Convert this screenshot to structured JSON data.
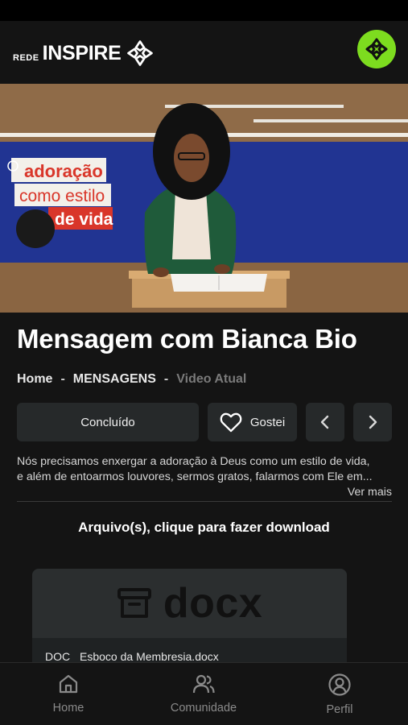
{
  "header": {
    "logo_prefix": "REDE",
    "logo_name": "INSPIRE",
    "logo_icon": "inspire-cross-logo",
    "avatar_icon": "inspire-cross-logo",
    "avatar_color": "#7ddc1f"
  },
  "video": {
    "banner_lines": [
      "adoração",
      "como estilo",
      "de vida"
    ]
  },
  "content": {
    "title": "Mensagem com Bianca Bio",
    "breadcrumb": {
      "home": "Home",
      "sep1": "-",
      "section": "MENSAGENS",
      "sep2": "-",
      "current": "Video Atual"
    },
    "actions": {
      "done_label": "Concluído",
      "like_label": "Gostei",
      "like_icon": "heart-icon",
      "prev_icon": "chevron-left-icon",
      "next_icon": "chevron-right-icon"
    },
    "description_line1": "Nós precisamos enxergar a adoração à Deus como um estilo de vida,",
    "description_line2": "e além de entoarmos louvores, sermos gratos, falarmos com Ele em...",
    "see_more": "Ver mais"
  },
  "files": {
    "heading": "Arquivo(s), clique para fazer download",
    "items": [
      {
        "preview_label": "docx",
        "type": "DOC",
        "name": "Esboco da Membresia.docx",
        "icon": "archive-box-icon"
      }
    ]
  },
  "tabbar": {
    "items": [
      {
        "label": "Home",
        "icon": "home-icon"
      },
      {
        "label": "Comunidade",
        "icon": "users-icon"
      },
      {
        "label": "Perfil",
        "icon": "user-circle-icon"
      }
    ]
  }
}
